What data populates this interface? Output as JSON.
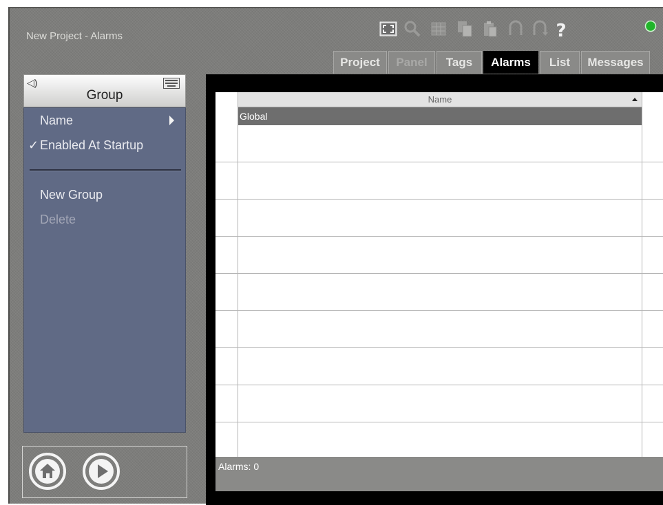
{
  "window": {
    "title": "New Project - Alarms"
  },
  "toolbar": {
    "icons": [
      "fullscreen-icon",
      "search-icon",
      "grid-icon",
      "copy-icon",
      "paste-icon",
      "undo-icon",
      "redo-icon",
      "help-icon",
      "status-led-icon"
    ],
    "status_color": "#21b42a"
  },
  "tabs": [
    {
      "label": "Project",
      "state": "normal"
    },
    {
      "label": "Panel",
      "state": "disabled"
    },
    {
      "label": "Tags",
      "state": "normal"
    },
    {
      "label": "Alarms",
      "state": "active"
    },
    {
      "label": "List",
      "state": "normal"
    },
    {
      "label": "Messages",
      "state": "normal"
    }
  ],
  "sidebar": {
    "back_glyph": "◁)",
    "title": "Group",
    "items": [
      {
        "label": "Name",
        "submenu": true
      },
      {
        "label": "Enabled At Startup",
        "checked": true
      },
      {
        "label": "New Group"
      },
      {
        "label": "Delete",
        "disabled": true
      }
    ]
  },
  "grid": {
    "columns": [
      "Name"
    ],
    "rows": [
      "Global",
      "",
      "",
      "",
      "",
      "",
      "",
      "",
      "",
      ""
    ],
    "selected_row": 0
  },
  "status": {
    "text": "Alarms: 0"
  },
  "colors": {
    "sidebar_bg": "#606a85",
    "app_bg": "#7d7d7b"
  }
}
